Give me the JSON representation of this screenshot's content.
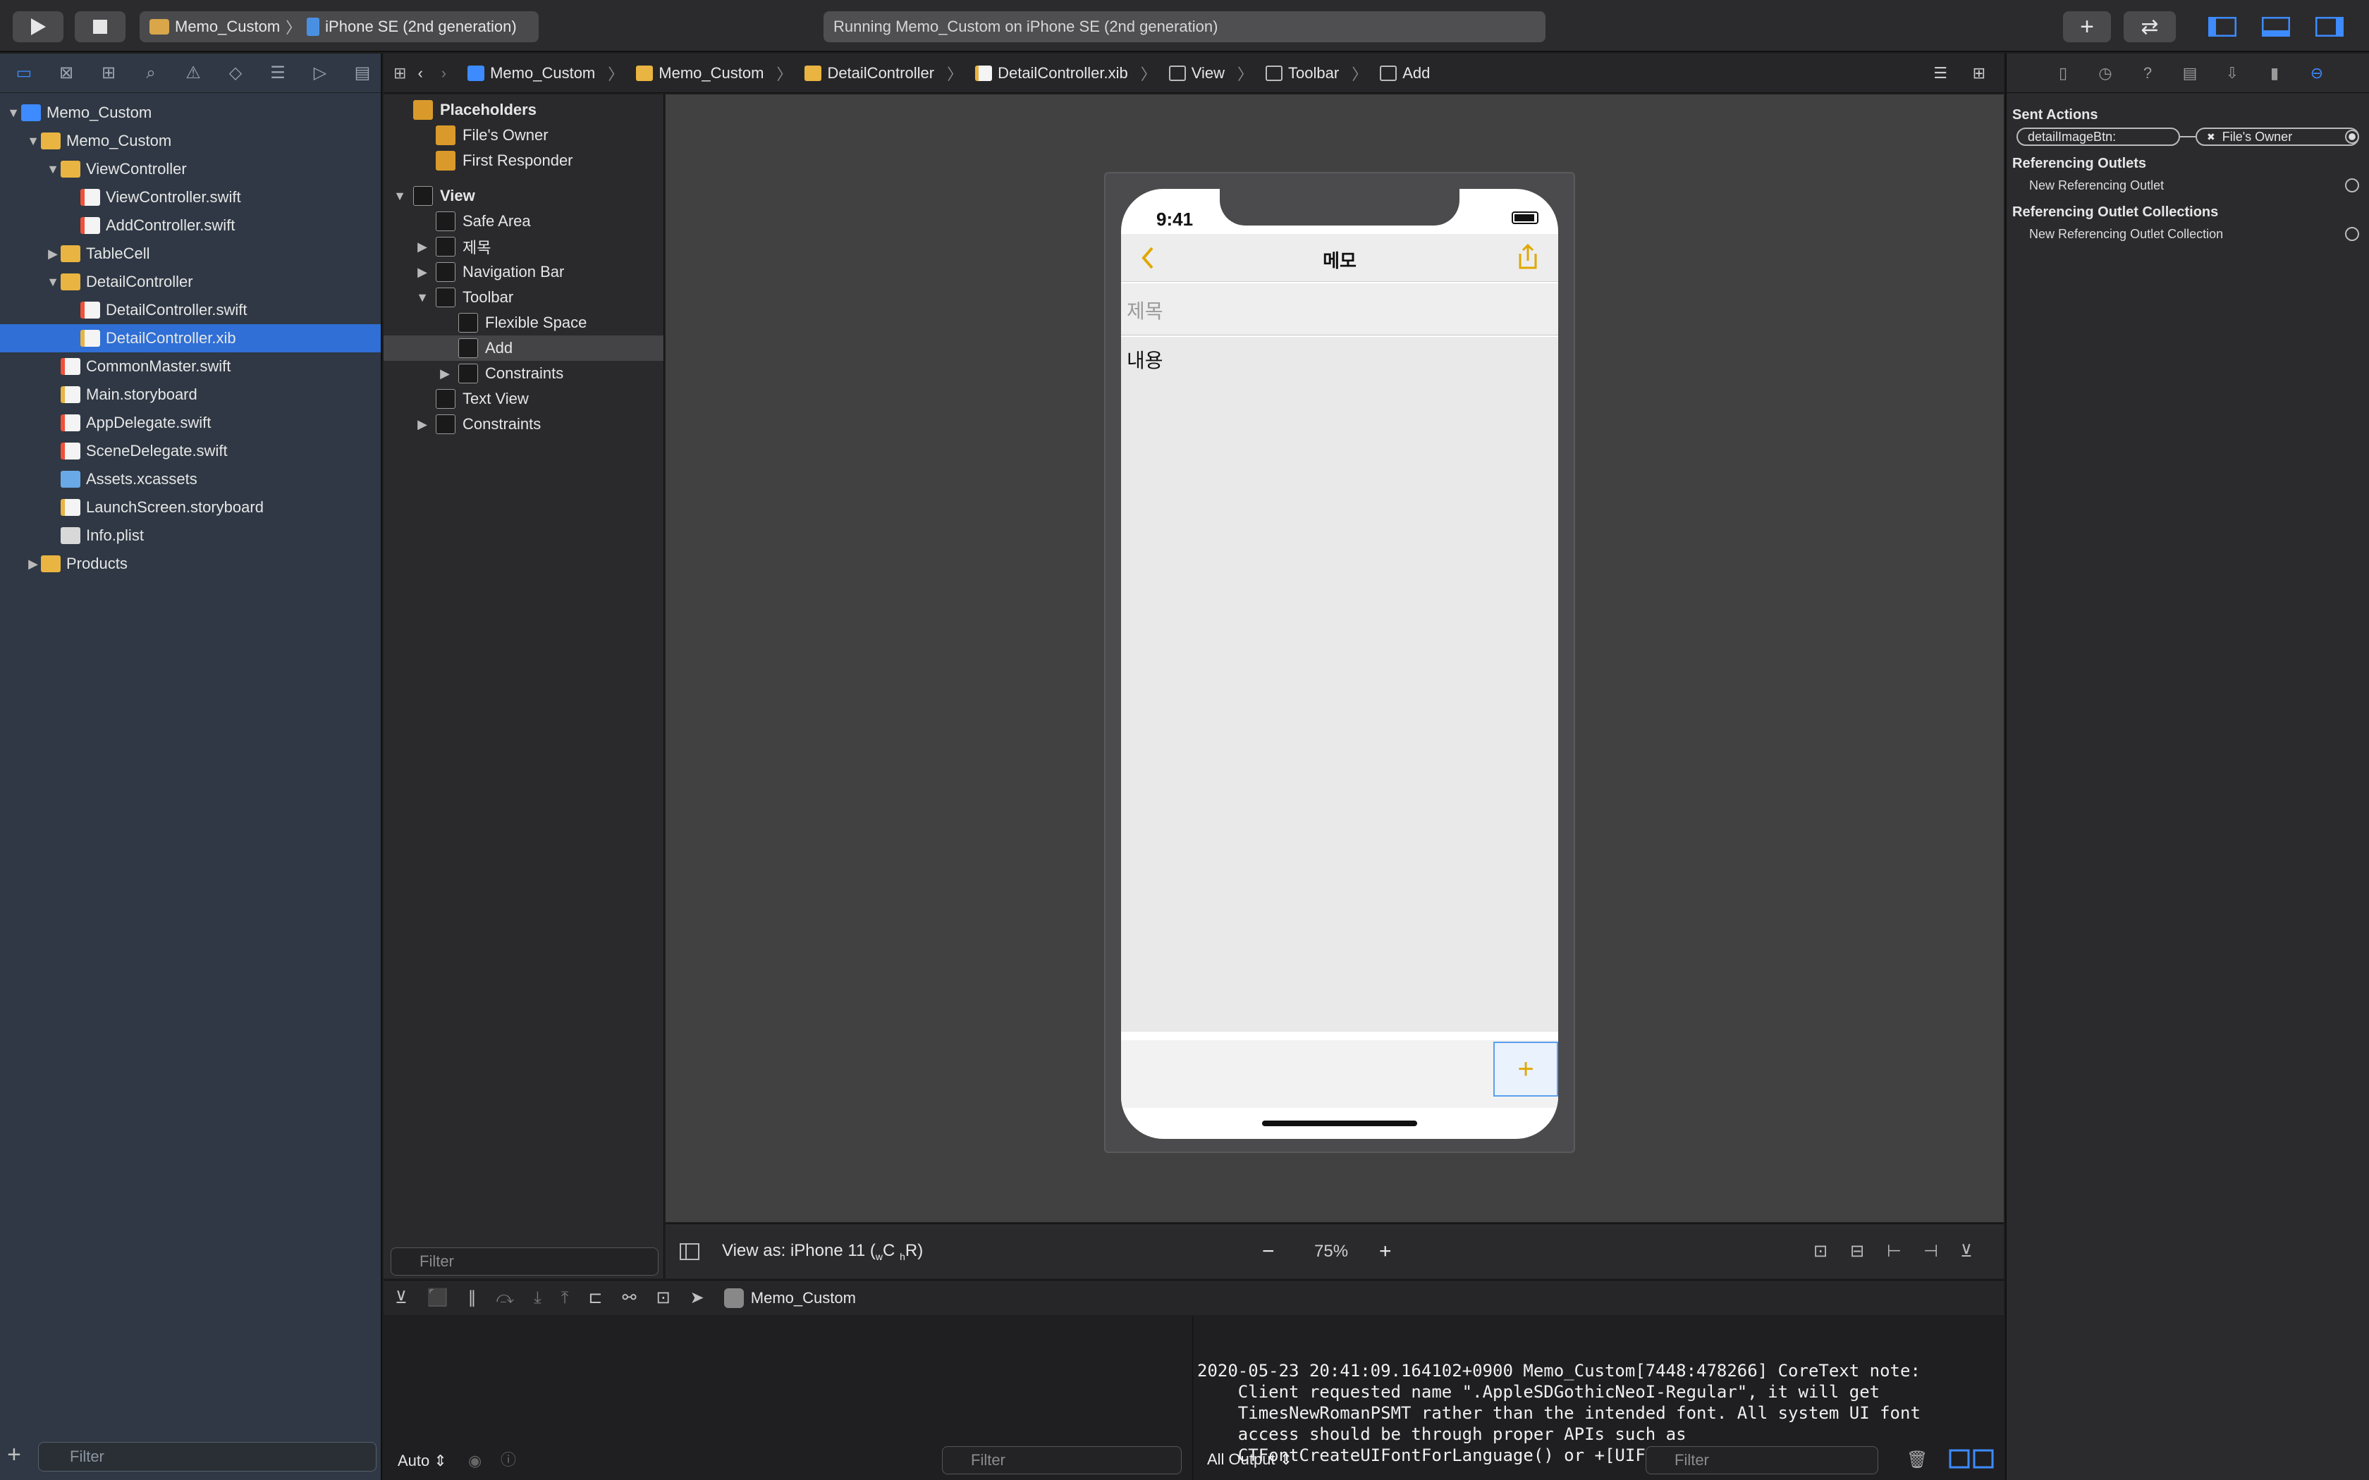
{
  "toolbar": {
    "scheme_project": "Memo_Custom",
    "scheme_device": "iPhone SE (2nd generation)",
    "activity": "Running Memo_Custom on iPhone SE (2nd generation)"
  },
  "navigator": {
    "tree": [
      {
        "label": "Memo_Custom",
        "indent": 0,
        "icon": "proj",
        "disclosure": "open"
      },
      {
        "label": "Memo_Custom",
        "indent": 1,
        "icon": "folder",
        "disclosure": "open"
      },
      {
        "label": "ViewController",
        "indent": 2,
        "icon": "folder",
        "disclosure": "open"
      },
      {
        "label": "ViewController.swift",
        "indent": 3,
        "icon": "swift",
        "disclosure": ""
      },
      {
        "label": "AddController.swift",
        "indent": 3,
        "icon": "swift",
        "disclosure": ""
      },
      {
        "label": "TableCell",
        "indent": 2,
        "icon": "folder",
        "disclosure": "closed"
      },
      {
        "label": "DetailController",
        "indent": 2,
        "icon": "folder",
        "disclosure": "open"
      },
      {
        "label": "DetailController.swift",
        "indent": 3,
        "icon": "swift",
        "disclosure": ""
      },
      {
        "label": "DetailController.xib",
        "indent": 3,
        "icon": "xib",
        "disclosure": "",
        "selected": true
      },
      {
        "label": "CommonMaster.swift",
        "indent": 2,
        "icon": "swift",
        "disclosure": ""
      },
      {
        "label": "Main.storyboard",
        "indent": 2,
        "icon": "xib",
        "disclosure": ""
      },
      {
        "label": "AppDelegate.swift",
        "indent": 2,
        "icon": "swift",
        "disclosure": ""
      },
      {
        "label": "SceneDelegate.swift",
        "indent": 2,
        "icon": "swift",
        "disclosure": ""
      },
      {
        "label": "Assets.xcassets",
        "indent": 2,
        "icon": "assets",
        "disclosure": ""
      },
      {
        "label": "LaunchScreen.storyboard",
        "indent": 2,
        "icon": "xib",
        "disclosure": ""
      },
      {
        "label": "Info.plist",
        "indent": 2,
        "icon": "plist",
        "disclosure": ""
      },
      {
        "label": "Products",
        "indent": 1,
        "icon": "folder",
        "disclosure": "closed"
      }
    ],
    "filter_placeholder": "Filter"
  },
  "jumpbar": {
    "crumbs": [
      "Memo_Custom",
      "Memo_Custom",
      "DetailController",
      "DetailController.xib",
      "View",
      "Toolbar",
      "Add"
    ]
  },
  "outline": {
    "rows": [
      {
        "label": "Placeholders",
        "indent": 0,
        "disclosure": "",
        "bold": true
      },
      {
        "label": "File's Owner",
        "indent": 1,
        "disclosure": ""
      },
      {
        "label": "First Responder",
        "indent": 1,
        "disclosure": ""
      },
      {
        "label": "View",
        "indent": 0,
        "disclosure": "open",
        "bold": true
      },
      {
        "label": "Safe Area",
        "indent": 1,
        "disclosure": ""
      },
      {
        "label": "제목",
        "indent": 1,
        "disclosure": "closed"
      },
      {
        "label": "Navigation Bar",
        "indent": 1,
        "disclosure": "closed"
      },
      {
        "label": "Toolbar",
        "indent": 1,
        "disclosure": "open"
      },
      {
        "label": "Flexible Space",
        "indent": 2,
        "disclosure": ""
      },
      {
        "label": "Add",
        "indent": 2,
        "disclosure": "",
        "selected": true
      },
      {
        "label": "Constraints",
        "indent": 2,
        "disclosure": "closed"
      },
      {
        "label": "Text View",
        "indent": 1,
        "disclosure": ""
      },
      {
        "label": "Constraints",
        "indent": 1,
        "disclosure": "closed"
      }
    ],
    "filter_placeholder": "Filter"
  },
  "canvas": {
    "view_as_label": "View as: iPhone 11 (",
    "view_as_w": "w",
    "view_as_c": "C",
    "view_as_h": "h",
    "view_as_r": "R)",
    "zoom": "75%"
  },
  "device": {
    "time": "9:41",
    "nav_title": "메모",
    "title_placeholder": "제목",
    "content_text": "내용",
    "add_symbol": "+"
  },
  "inspector": {
    "sent_actions_header": "Sent Actions",
    "action_name": "detailImageBtn:",
    "action_target": "File's Owner",
    "referencing_outlets_header": "Referencing Outlets",
    "new_referencing_outlet": "New Referencing Outlet",
    "referencing_collections_header": "Referencing Outlet Collections",
    "new_referencing_collection": "New Referencing Outlet Collection"
  },
  "debug": {
    "target_label": "Memo_Custom",
    "console_text": "2020-05-23 20:41:09.164102+0900 Memo_Custom[7448:478266] CoreText note:\n    Client requested name \".AppleSDGothicNeoI-Regular\", it will get\n    TimesNewRomanPSMT rather than the intended font. All system UI font\n    access should be through proper APIs such as\n    CTFontCreateUIFontForLanguage() or +[UIFont systemFontOfSize:].",
    "auto_label": "Auto",
    "all_output_label": "All Output",
    "filter_placeholder": "Filter"
  }
}
